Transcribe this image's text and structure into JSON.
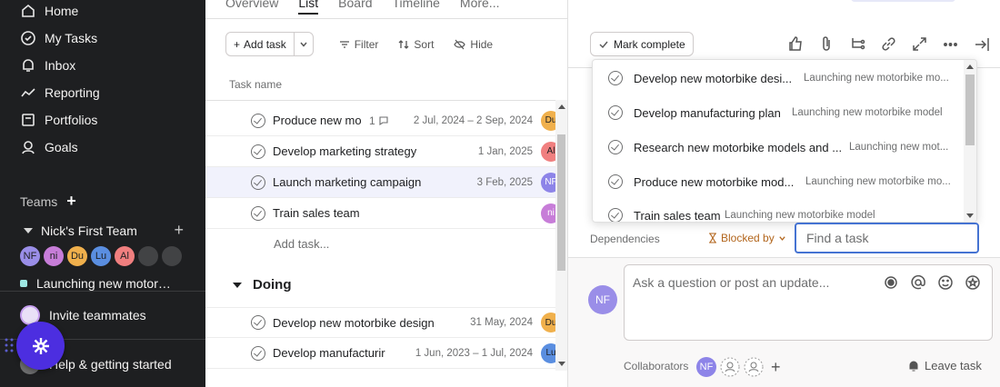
{
  "sidebar": {
    "nav": [
      {
        "label": "Home",
        "icon": "home-icon"
      },
      {
        "label": "My Tasks",
        "icon": "check-circle-icon"
      },
      {
        "label": "Inbox",
        "icon": "bell-icon"
      },
      {
        "label": "Reporting",
        "icon": "trend-icon"
      },
      {
        "label": "Portfolios",
        "icon": "folder-icon"
      },
      {
        "label": "Goals",
        "icon": "person-icon"
      }
    ],
    "teams_label": "Teams",
    "team_name": "Nick's First Team",
    "team_members": [
      {
        "initials": "NF",
        "color": "#9a8ee8"
      },
      {
        "initials": "ni",
        "color": "#c77dd8"
      },
      {
        "initials": "Du",
        "color": "#f0b04c"
      },
      {
        "initials": "Lu",
        "color": "#5a8ee0"
      },
      {
        "initials": "Al",
        "color": "#f07f7f"
      },
      {
        "initials": "",
        "color": "#424345"
      },
      {
        "initials": "",
        "color": "#424345"
      }
    ],
    "project": "Launching new motor…",
    "invite": "Invite teammates",
    "help": "Help & getting started"
  },
  "main": {
    "tabs": [
      "Overview",
      "List",
      "Board",
      "Timeline",
      "More..."
    ],
    "active_tab": "List",
    "toolbar": {
      "add_task": "Add task",
      "filter": "Filter",
      "sort": "Sort",
      "hide": "Hide"
    },
    "column_header": "Task name",
    "rows": [
      {
        "name": "Produce new mo",
        "subtasks": "1",
        "date": "2 Jul, 2024 – 2 Sep, 2024",
        "assignee": "Du",
        "color": "#f0b04c"
      },
      {
        "name": "Develop marketing strategy",
        "subtasks": "",
        "date": "1 Jan, 2025",
        "assignee": "Al",
        "color": "#f07f7f"
      },
      {
        "name": "Launch marketing campaign",
        "subtasks": "",
        "date": "3 Feb, 2025",
        "assignee": "NF",
        "color": "#8d84e8"
      },
      {
        "name": "Train sales team",
        "subtasks": "",
        "date": "",
        "assignee": "ni",
        "color": "#c77dd8"
      }
    ],
    "add_task_inline": "Add task...",
    "section": "Doing",
    "doing_rows": [
      {
        "name": "Develop new motorbike design",
        "date": "31 May, 2024",
        "assignee": "Du",
        "color": "#f0b04c"
      },
      {
        "name": "Develop manufacturir",
        "date": "1 Jun, 2023 – 1 Jul, 2024",
        "assignee": "Lu",
        "color": "#5a8ee0"
      }
    ]
  },
  "panel": {
    "mark_complete": "Mark complete",
    "dropdown": [
      {
        "name": "Develop new motorbike desi...",
        "project": "Launching new motorbike mo..."
      },
      {
        "name": "Develop manufacturing plan",
        "project": "Launching new motorbike model"
      },
      {
        "name": "Research new motorbike models and ...",
        "project": "Launching new mot..."
      },
      {
        "name": "Produce new motorbike mod...",
        "project": "Launching new motorbike mo..."
      },
      {
        "name": "Train sales team",
        "project": "Launching new motorbike model"
      }
    ],
    "dependencies_label": "Dependencies",
    "blocked_by": "Blocked by",
    "find_placeholder": "Find a task",
    "comment_placeholder": "Ask a question or post an update...",
    "me_initials": "NF",
    "collaborators_label": "Collaborators",
    "collaborator_initials": "NF",
    "leave_task": "Leave task"
  }
}
